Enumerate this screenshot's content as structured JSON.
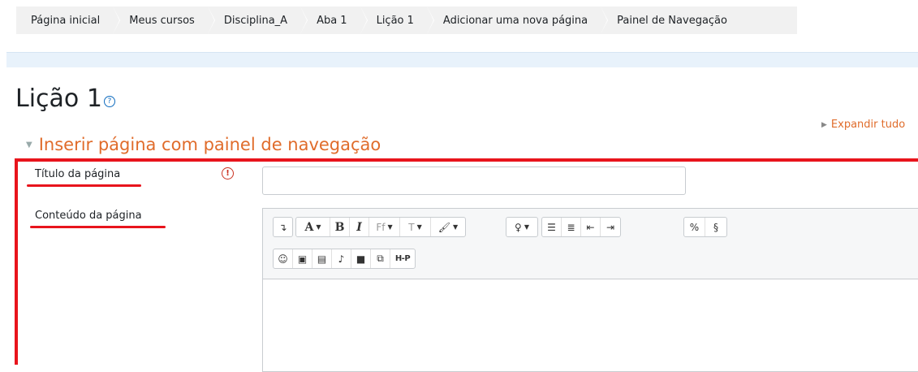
{
  "breadcrumb": [
    "Página inicial",
    "Meus cursos",
    "Disciplina_A",
    "Aba 1",
    "Lição 1",
    "Adicionar uma nova página",
    "Painel de Navegação"
  ],
  "page": {
    "title": "Lição 1",
    "help_icon": "question-circle-icon"
  },
  "expand_all_label": "Expandir tudo",
  "section": {
    "title": "Inserir página com painel de navegação"
  },
  "form": {
    "title_label": "Título da página",
    "title_value": "",
    "required_icon": "exclamation-circle-icon",
    "content_label": "Conteúdo da página"
  },
  "editor": {
    "row1": [
      "toggle-toolbar",
      "font-color",
      "bold",
      "italic",
      "font-family",
      "font-size",
      "highlight",
      "lightbulb",
      "unordered-list",
      "ordered-list",
      "outdent",
      "indent",
      "link",
      "unlink"
    ],
    "row2": [
      "emoji",
      "image",
      "media-file",
      "record-audio",
      "record-video",
      "manage-files",
      "h5p"
    ],
    "labels": {
      "font_color": "A",
      "bold": "B",
      "italic": "I",
      "font_family": "Ff",
      "font_size": "T",
      "h5p": "H-P"
    }
  },
  "colors": {
    "accent_orange": "#e06c2b",
    "annotation_red": "#e8141c",
    "link_blue": "#0f6cbf"
  }
}
